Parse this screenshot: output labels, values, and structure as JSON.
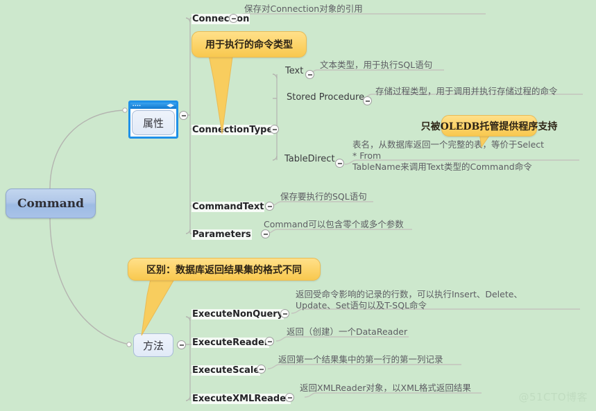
{
  "watermark": "@51CTO博客",
  "root": {
    "label": "Command"
  },
  "branches": [
    {
      "id": "attributes",
      "label": "属性"
    },
    {
      "id": "methods",
      "label": "方法"
    }
  ],
  "callouts": [
    {
      "id": "command-type",
      "text": "用于执行的命令类型"
    },
    {
      "id": "oledb-only",
      "text": "只被OLEDB托管提供程序支持"
    },
    {
      "id": "difference",
      "text": "区别：数据库返回结果集的格式不同"
    }
  ],
  "attributes_children": [
    {
      "label": "Connection",
      "note": "保存对Connection对象的引用"
    },
    {
      "label": "ConnectionType",
      "note": "",
      "children": [
        {
          "label": "Text",
          "note": "文本类型，用于执行SQL语句"
        },
        {
          "label": "Stored Procedure",
          "note": "存储过程类型，用于调用并执行存储过程的命令"
        },
        {
          "label": "TableDirect",
          "note": "表名，从数据库返回一个完整的表，等价于Select\n* From\nTableName来调用Text类型的Command命令"
        }
      ]
    },
    {
      "label": "CommandText",
      "note": "保存要执行的SQL语句"
    },
    {
      "label": "Parameters",
      "note": "Command可以包含零个或多个参数"
    }
  ],
  "methods_children": [
    {
      "label": "ExecuteNonQuery",
      "note": "返回受命令影响的记录的行数，可以执行Insert、Delete、\nUpdate、Set语句以及T-SQL命令"
    },
    {
      "label": "ExecuteReader",
      "note": "返回（创建）一个DataReader"
    },
    {
      "label": "ExecuteScale",
      "note": "返回第一个结果集中的第一行的第一列记录"
    },
    {
      "label": "ExecuteXMLReader",
      "note": "返回XMLReader对象，以XML格式返回结果"
    }
  ],
  "colors": {
    "background": "#cde8cd",
    "root_fill": "#aac4e8",
    "callout_fill": "#fcd368",
    "branch_frame": "#1e90e8",
    "wire": "#b4b4b0",
    "note_text": "#5d5d63"
  }
}
